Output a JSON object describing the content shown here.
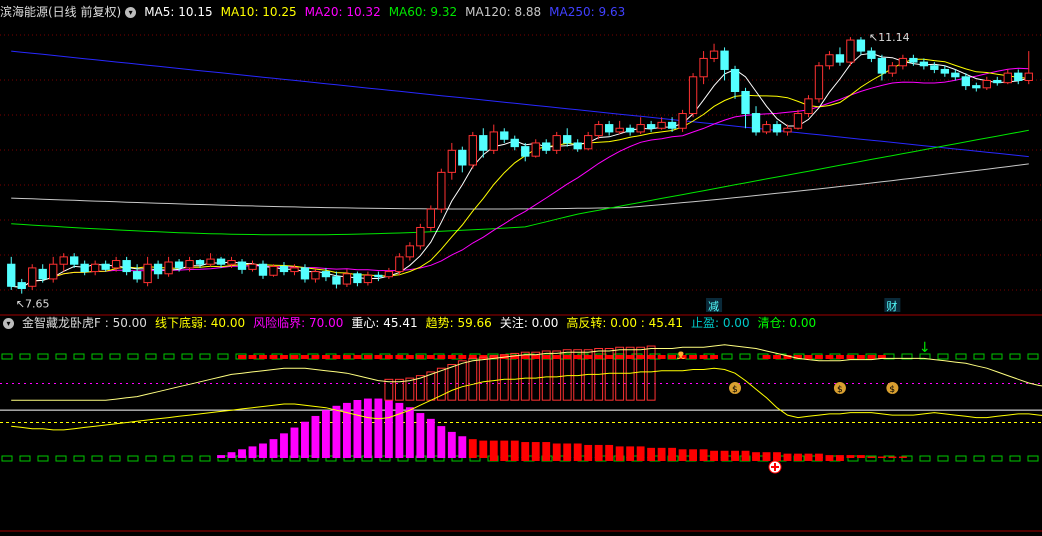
{
  "colors": {
    "up": "#ff3232",
    "down": "#54ffff",
    "ma5": "#ffffff",
    "ma10": "#ffff00",
    "ma20": "#ff00ff",
    "ma60": "#00e600",
    "ma120": "#c8c8c8",
    "ma250": "#2828ff",
    "grid": "#7a0000",
    "border": "#a00000",
    "magenta_bar": "#ff00ff",
    "red_dash": "#ff0000",
    "green_dash": "#00c800"
  },
  "header": {
    "stock_name": "滨海能源(日线 前复权)",
    "menu_icon": "chevron-down-icon",
    "ma5": "MA5: 10.15",
    "ma10": "MA10: 10.25",
    "ma20": "MA20: 10.32",
    "ma60": "MA60: 9.32",
    "ma120": "MA120: 8.88",
    "ma250": "MA250: 9.63"
  },
  "main_chart": {
    "high_label": "11.14",
    "low_label": "7.65",
    "event_labels": [
      "减",
      "财"
    ]
  },
  "indicator": {
    "name": "金智藏龙卧虎F : 50.00",
    "xiaxian": "线下底弱: 40.00",
    "fengxian": "风险临界: 70.00",
    "zhongxin": "重心: 45.41",
    "qushi": "趋势: 59.66",
    "guanzhu": "关注: 0.00",
    "gaofanzhuan": "高反转: 0.00 : 45.41",
    "zhiying": "止盈: 0.00",
    "qingcang": "清仓: 0.00"
  },
  "chart_data": {
    "type": "candlestick",
    "y_range": [
      7.4,
      11.4
    ],
    "candles": [
      [
        8.05,
        7.75,
        8.15,
        7.7
      ],
      [
        7.8,
        7.72,
        7.85,
        7.65
      ],
      [
        7.75,
        8.0,
        8.05,
        7.7
      ],
      [
        7.98,
        7.85,
        8.05,
        7.8
      ],
      [
        7.85,
        8.05,
        8.15,
        7.8
      ],
      [
        8.05,
        8.15,
        8.2,
        7.95
      ],
      [
        8.15,
        8.05,
        8.2,
        8.0
      ],
      [
        8.05,
        7.95,
        8.1,
        7.9
      ],
      [
        7.95,
        8.05,
        8.1,
        7.9
      ],
      [
        8.05,
        7.98,
        8.1,
        7.95
      ],
      [
        8.0,
        8.1,
        8.15,
        7.95
      ],
      [
        8.1,
        7.95,
        8.15,
        7.9
      ],
      [
        7.95,
        7.85,
        8.05,
        7.8
      ],
      [
        7.8,
        8.05,
        8.15,
        7.75
      ],
      [
        8.05,
        7.92,
        8.1,
        7.85
      ],
      [
        7.92,
        8.08,
        8.15,
        7.88
      ],
      [
        8.08,
        8.0,
        8.12,
        7.95
      ],
      [
        8.0,
        8.1,
        8.15,
        7.95
      ],
      [
        8.1,
        8.05,
        8.12,
        8.0
      ],
      [
        8.05,
        8.12,
        8.2,
        8.02
      ],
      [
        8.12,
        8.05,
        8.15,
        8.0
      ],
      [
        8.05,
        8.1,
        8.15,
        8.0
      ],
      [
        8.08,
        7.98,
        8.12,
        7.92
      ],
      [
        7.98,
        8.05,
        8.1,
        7.95
      ],
      [
        8.05,
        7.9,
        8.1,
        7.85
      ],
      [
        7.9,
        8.02,
        8.05,
        7.88
      ],
      [
        8.02,
        7.95,
        8.08,
        7.9
      ],
      [
        7.95,
        8.0,
        8.05,
        7.9
      ],
      [
        8.0,
        7.85,
        8.05,
        7.8
      ],
      [
        7.85,
        7.95,
        8.0,
        7.8
      ],
      [
        7.95,
        7.88,
        8.0,
        7.82
      ],
      [
        7.88,
        7.78,
        7.95,
        7.72
      ],
      [
        7.78,
        7.92,
        7.98,
        7.74
      ],
      [
        7.92,
        7.8,
        7.95,
        7.75
      ],
      [
        7.8,
        7.9,
        7.95,
        7.76
      ],
      [
        7.9,
        7.88,
        7.95,
        7.82
      ],
      [
        7.88,
        7.95,
        8.0,
        7.85
      ],
      [
        7.95,
        8.15,
        8.2,
        7.9
      ],
      [
        8.15,
        8.3,
        8.35,
        8.1
      ],
      [
        8.3,
        8.55,
        8.6,
        8.25
      ],
      [
        8.55,
        8.8,
        8.85,
        8.5
      ],
      [
        8.8,
        9.3,
        9.35,
        8.75
      ],
      [
        9.3,
        9.6,
        9.7,
        9.2
      ],
      [
        9.6,
        9.4,
        9.65,
        9.3
      ],
      [
        9.4,
        9.8,
        9.85,
        9.35
      ],
      [
        9.8,
        9.6,
        9.9,
        9.5
      ],
      [
        9.6,
        9.85,
        9.95,
        9.55
      ],
      [
        9.85,
        9.75,
        9.9,
        9.7
      ],
      [
        9.75,
        9.65,
        9.8,
        9.6
      ],
      [
        9.65,
        9.52,
        9.7,
        9.45
      ],
      [
        9.52,
        9.7,
        9.75,
        9.5
      ],
      [
        9.7,
        9.6,
        9.75,
        9.55
      ],
      [
        9.6,
        9.8,
        9.85,
        9.55
      ],
      [
        9.8,
        9.7,
        9.9,
        9.65
      ],
      [
        9.7,
        9.62,
        9.75,
        9.58
      ],
      [
        9.62,
        9.8,
        9.85,
        9.6
      ],
      [
        9.8,
        9.95,
        10.0,
        9.75
      ],
      [
        9.95,
        9.85,
        10.0,
        9.8
      ],
      [
        9.85,
        9.9,
        10.0,
        9.82
      ],
      [
        9.9,
        9.85,
        9.95,
        9.8
      ],
      [
        9.85,
        9.95,
        10.05,
        9.82
      ],
      [
        9.95,
        9.9,
        10.0,
        9.85
      ],
      [
        9.9,
        9.98,
        10.05,
        9.88
      ],
      [
        9.98,
        9.9,
        10.05,
        9.85
      ],
      [
        9.9,
        10.1,
        10.15,
        9.85
      ],
      [
        10.1,
        10.6,
        10.65,
        10.05
      ],
      [
        10.6,
        10.85,
        10.95,
        10.5
      ],
      [
        10.85,
        10.95,
        11.05,
        10.8
      ],
      [
        10.95,
        10.7,
        11.0,
        10.55
      ],
      [
        10.7,
        10.4,
        10.75,
        10.3
      ],
      [
        10.4,
        10.1,
        10.45,
        9.9
      ],
      [
        10.1,
        9.85,
        10.2,
        9.8
      ],
      [
        9.85,
        9.95,
        10.0,
        9.82
      ],
      [
        9.95,
        9.85,
        10.0,
        9.8
      ],
      [
        9.85,
        9.9,
        9.95,
        9.8
      ],
      [
        9.9,
        10.1,
        10.15,
        9.88
      ],
      [
        10.1,
        10.3,
        10.35,
        10.05
      ],
      [
        10.3,
        10.75,
        10.8,
        10.25
      ],
      [
        10.75,
        10.9,
        10.95,
        10.7
      ],
      [
        10.9,
        10.8,
        11.0,
        10.75
      ],
      [
        10.8,
        11.1,
        11.14,
        10.75
      ],
      [
        11.1,
        10.95,
        11.14,
        10.9
      ],
      [
        10.95,
        10.85,
        11.0,
        10.8
      ],
      [
        10.85,
        10.65,
        10.9,
        10.55
      ],
      [
        10.65,
        10.75,
        10.8,
        10.6
      ],
      [
        10.75,
        10.85,
        10.9,
        10.7
      ],
      [
        10.85,
        10.8,
        10.9,
        10.75
      ],
      [
        10.8,
        10.75,
        10.85,
        10.7
      ],
      [
        10.75,
        10.7,
        10.8,
        10.65
      ],
      [
        10.7,
        10.65,
        10.75,
        10.6
      ],
      [
        10.65,
        10.6,
        10.7,
        10.55
      ],
      [
        10.6,
        10.48,
        10.65,
        10.42
      ],
      [
        10.48,
        10.45,
        10.52,
        10.4
      ],
      [
        10.45,
        10.55,
        10.6,
        10.42
      ],
      [
        10.55,
        10.52,
        10.6,
        10.48
      ],
      [
        10.52,
        10.65,
        10.7,
        10.5
      ],
      [
        10.65,
        10.55,
        10.7,
        10.5
      ],
      [
        10.55,
        10.65,
        10.95,
        10.5
      ]
    ],
    "ind_range": [
      -5,
      115
    ],
    "ind_levels": [
      40,
      50,
      70
    ],
    "bars": [
      0,
      0,
      0,
      0,
      0,
      0,
      0,
      0,
      0,
      0,
      0,
      0,
      0,
      0,
      0,
      0,
      0,
      0,
      0,
      0,
      2,
      4,
      6,
      8,
      10,
      13,
      17,
      21,
      25,
      29,
      33,
      36,
      38,
      40,
      41,
      41,
      40,
      38,
      35,
      31,
      27,
      22,
      18,
      15,
      13,
      12,
      12,
      12,
      12,
      11,
      11,
      11,
      10,
      10,
      10,
      9,
      9,
      9,
      8,
      8,
      8,
      7,
      7,
      7,
      6,
      6,
      6,
      5,
      5,
      5,
      5,
      4,
      4,
      4,
      3,
      3,
      3,
      3,
      2,
      2,
      2,
      2,
      1,
      1,
      1,
      1,
      0,
      0,
      0,
      0,
      0,
      0,
      0,
      0,
      0,
      0,
      0,
      0
    ],
    "trend": [
      37,
      36,
      35,
      35,
      34,
      34,
      35,
      36,
      37,
      38,
      39,
      40,
      41,
      42,
      43,
      44,
      45,
      46,
      47,
      48,
      49,
      50,
      51,
      52,
      53,
      54,
      55,
      55,
      54,
      53,
      52,
      50,
      48,
      46,
      44,
      43,
      44,
      47,
      50,
      54,
      58,
      62,
      66,
      69,
      71,
      73,
      74,
      75,
      75,
      76,
      76,
      77,
      77,
      78,
      78,
      79,
      79,
      80,
      80,
      80,
      81,
      81,
      82,
      82,
      82,
      83,
      83,
      84,
      83,
      80,
      74,
      67,
      60,
      52,
      46,
      44,
      45,
      46,
      47,
      47,
      48,
      48,
      48,
      47,
      46,
      46,
      46,
      47,
      48,
      47,
      46,
      45,
      44,
      44,
      45,
      46,
      47,
      47,
      46,
      45,
      44,
      43,
      43,
      42,
      42,
      44
    ],
    "heavy_line": [
      40,
      40,
      40,
      40,
      40,
      40,
      40,
      40,
      40,
      40,
      41,
      42,
      43,
      45,
      47,
      49,
      51,
      53,
      55,
      57,
      59,
      61,
      62,
      63,
      64,
      65,
      66,
      66,
      66,
      65,
      64,
      63,
      62,
      60,
      58,
      56,
      55,
      55,
      56,
      58,
      61,
      64,
      67,
      70,
      72,
      73,
      74,
      75,
      76,
      77,
      77,
      78,
      78,
      79,
      79,
      79,
      80,
      80,
      81,
      81,
      81,
      82,
      82,
      82,
      83,
      83,
      83,
      84,
      85,
      84,
      83,
      82,
      80,
      78,
      76,
      74,
      73,
      72,
      72,
      72,
      73,
      73,
      73,
      74,
      74,
      74,
      74,
      74,
      73,
      72,
      71,
      70,
      68,
      66,
      63,
      60,
      57,
      54,
      52,
      51
    ],
    "markers": [
      {
        "type": "person",
        "i": 64
      },
      {
        "type": "money",
        "i": 69
      },
      {
        "type": "money",
        "i": 79
      },
      {
        "type": "money",
        "i": 84
      },
      {
        "type": "arrow",
        "i": 87
      },
      {
        "type": "plus",
        "i": 99
      }
    ]
  }
}
